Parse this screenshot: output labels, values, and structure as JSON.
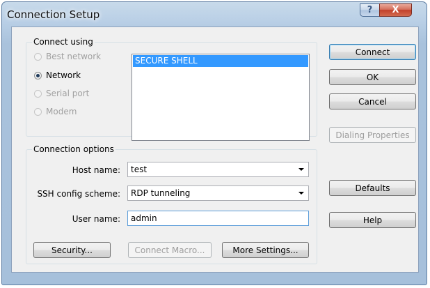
{
  "window": {
    "title": "Connection Setup",
    "help_label": "?",
    "close_label": "X"
  },
  "connect_using": {
    "legend": "Connect using",
    "options": [
      {
        "label": "Best network",
        "state": "disabled"
      },
      {
        "label": "Network",
        "state": "selected"
      },
      {
        "label": "Serial port",
        "state": "disabled"
      },
      {
        "label": "Modem",
        "state": "disabled"
      }
    ],
    "list_items": [
      "SECURE SHELL"
    ],
    "selected_item": "SECURE SHELL"
  },
  "connection_options": {
    "legend": "Connection options",
    "host_label": "Host name:",
    "host_value": "test",
    "scheme_label": "SSH config scheme:",
    "scheme_value": "RDP tunneling",
    "user_label": "User name:",
    "user_value": "admin",
    "security_button": "Security...",
    "macro_button": "Connect Macro...",
    "more_settings_button": "More Settings..."
  },
  "buttons": {
    "connect": "Connect",
    "ok": "OK",
    "cancel": "Cancel",
    "dialing": "Dialing Properties",
    "defaults": "Defaults",
    "help": "Help"
  }
}
